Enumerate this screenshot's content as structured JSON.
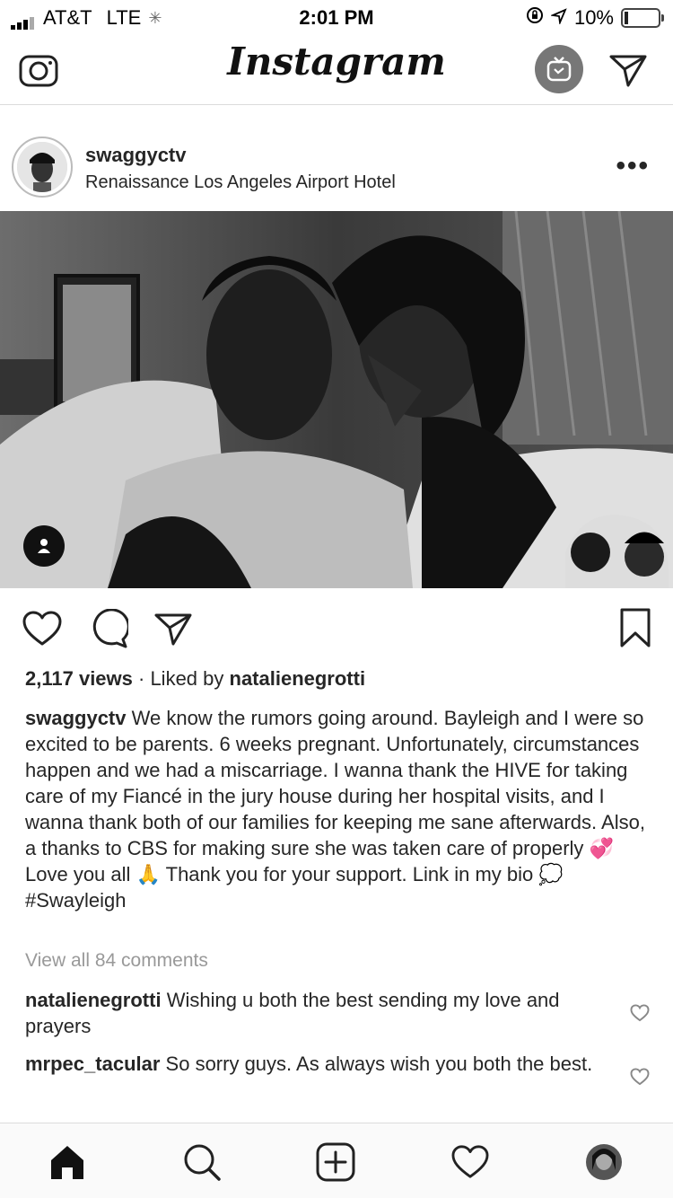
{
  "status_bar": {
    "carrier": "AT&T",
    "network": "LTE",
    "time": "2:01 PM",
    "battery": "10%"
  },
  "header": {
    "logo": "Instagram",
    "icons": [
      "camera-icon",
      "igtv-icon",
      "direct-message-icon"
    ]
  },
  "post": {
    "username": "swaggyctv",
    "location": "Renaissance Los Angeles Airport Hotel",
    "more_label": "•••",
    "views_count": "2,117 views",
    "liked_by_prefix": " · Liked by ",
    "liked_by_user": "natalienegrotti",
    "caption_user": "swaggyctv",
    "caption_text": "We know the rumors going around. Bayleigh and I were so excited to be parents. 6 weeks pregnant. Unfortunately, circumstances happen and we had a miscarriage. I wanna thank the HIVE for taking care of my Fiancé in the jury house during her hospital visits, and I wanna thank both of our families for keeping me sane afterwards. Also, a thanks to CBS for making sure she was taken care of properly 💞 Love you all 🙏 Thank you for your support. Link in my bio 💭 #Swayleigh",
    "view_all_comments": "View all 84 comments",
    "comments": [
      {
        "user": "natalienegrotti",
        "text": "Wishing u both the best sending my love and prayers"
      },
      {
        "user": "mrpec_tacular",
        "text": "So sorry guys. As always wish you both the best."
      }
    ]
  },
  "bottom_nav": {
    "items": [
      "home-icon",
      "search-icon",
      "new-post-icon",
      "activity-icon",
      "profile-avatar"
    ]
  }
}
